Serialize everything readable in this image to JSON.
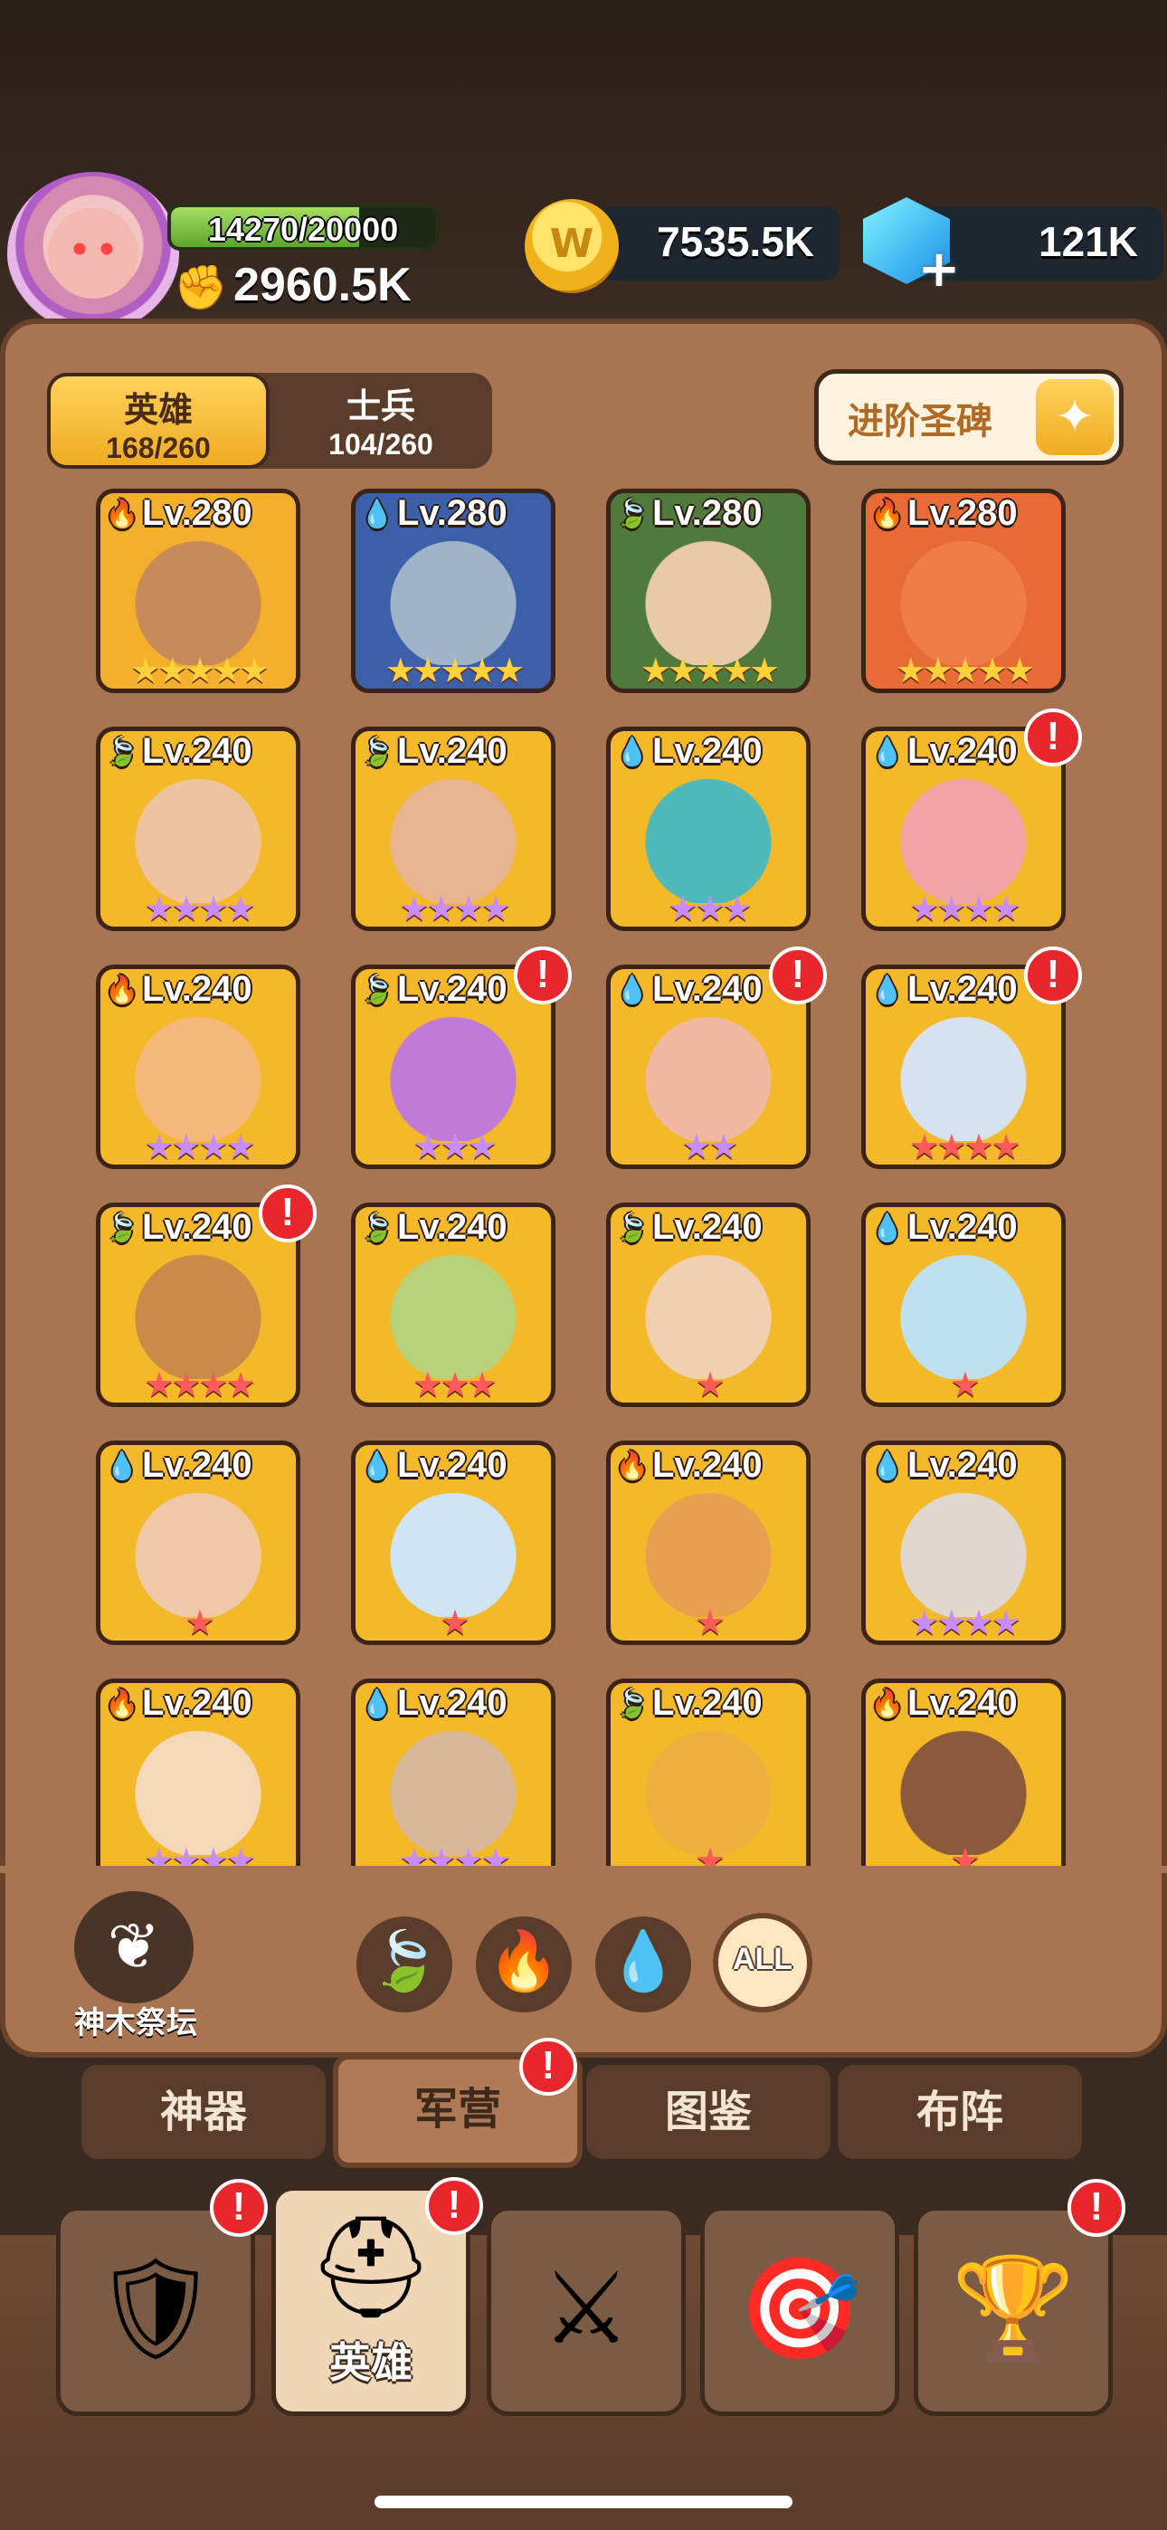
{
  "header": {
    "hp": {
      "text": "14270/20000",
      "fraction": 0.7135
    },
    "power": "2960.5K",
    "gold": "7535.5K",
    "gems": "121K"
  },
  "panel_tabs": [
    {
      "label": "英雄",
      "count": "168/260",
      "active": true
    },
    {
      "label": "士兵",
      "count": "104/260",
      "active": false
    }
  ],
  "ascend_button": {
    "label": "进阶圣碑"
  },
  "heroes": [
    {
      "level": "Lv.280",
      "element": "fire",
      "stars": 5,
      "star_color": "gold",
      "alert": false,
      "bg": "#f4b02c",
      "skin": "#c98a5a"
    },
    {
      "level": "Lv.280",
      "element": "water",
      "stars": 5,
      "star_color": "gold",
      "alert": false,
      "bg": "#3b5fa8",
      "skin": "#9fb4c8"
    },
    {
      "level": "Lv.280",
      "element": "leaf",
      "stars": 5,
      "star_color": "gold",
      "alert": false,
      "bg": "#4f7a3c",
      "skin": "#e8c9a8"
    },
    {
      "level": "Lv.280",
      "element": "fire",
      "stars": 5,
      "star_color": "gold",
      "alert": false,
      "bg": "#e86a36",
      "skin": "#f07c4a"
    },
    {
      "level": "Lv.240",
      "element": "leaf",
      "stars": 4,
      "star_color": "purple",
      "alert": false,
      "bg": "#f3b928",
      "skin": "#f0c3a0"
    },
    {
      "level": "Lv.240",
      "element": "leaf",
      "stars": 4,
      "star_color": "purple",
      "alert": false,
      "bg": "#f3b928",
      "skin": "#e9b590"
    },
    {
      "level": "Lv.240",
      "element": "water",
      "stars": 3,
      "star_color": "purple",
      "alert": false,
      "bg": "#f3b928",
      "skin": "#4fb8b8"
    },
    {
      "level": "Lv.240",
      "element": "water",
      "stars": 4,
      "star_color": "purple",
      "alert": true,
      "bg": "#f3b928",
      "skin": "#f0a4a4"
    },
    {
      "level": "Lv.240",
      "element": "fire",
      "stars": 4,
      "star_color": "purple",
      "alert": false,
      "bg": "#f3b928",
      "skin": "#f4b97a"
    },
    {
      "level": "Lv.240",
      "element": "leaf",
      "stars": 3,
      "star_color": "purple",
      "alert": true,
      "bg": "#f3b928",
      "skin": "#c27ad8"
    },
    {
      "level": "Lv.240",
      "element": "water",
      "stars": 2,
      "star_color": "purple",
      "alert": true,
      "bg": "#f3b928",
      "skin": "#f0b8a0"
    },
    {
      "level": "Lv.240",
      "element": "water",
      "stars": 4,
      "star_color": "red",
      "alert": true,
      "bg": "#f3b928",
      "skin": "#d6e2f0"
    },
    {
      "level": "Lv.240",
      "element": "leaf",
      "stars": 4,
      "star_color": "red",
      "alert": true,
      "bg": "#f3b928",
      "skin": "#c98a4a"
    },
    {
      "level": "Lv.240",
      "element": "leaf",
      "stars": 3,
      "star_color": "red",
      "alert": false,
      "bg": "#f3b928",
      "skin": "#b8d27a"
    },
    {
      "level": "Lv.240",
      "element": "leaf",
      "stars": 1,
      "star_color": "red",
      "alert": false,
      "bg": "#f3b928",
      "skin": "#f0d0b0"
    },
    {
      "level": "Lv.240",
      "element": "water",
      "stars": 1,
      "star_color": "red",
      "alert": false,
      "bg": "#f3b928",
      "skin": "#bfe0f0"
    },
    {
      "level": "Lv.240",
      "element": "water",
      "stars": 1,
      "star_color": "red",
      "alert": false,
      "bg": "#f3b928",
      "skin": "#f0c8a8"
    },
    {
      "level": "Lv.240",
      "element": "water",
      "stars": 1,
      "star_color": "red",
      "alert": false,
      "bg": "#f3b928",
      "skin": "#cfe4f4"
    },
    {
      "level": "Lv.240",
      "element": "fire",
      "stars": 1,
      "star_color": "red",
      "alert": false,
      "bg": "#f3b928",
      "skin": "#e8a050"
    },
    {
      "level": "Lv.240",
      "element": "water",
      "stars": 4,
      "star_color": "purple",
      "alert": false,
      "bg": "#f3b928",
      "skin": "#e0d8d0"
    },
    {
      "level": "Lv.240",
      "element": "fire",
      "stars": 4,
      "star_color": "purple",
      "alert": false,
      "bg": "#f3b928",
      "skin": "#f4d8b8"
    },
    {
      "level": "Lv.240",
      "element": "water",
      "stars": 4,
      "star_color": "purple",
      "alert": false,
      "bg": "#f3b928",
      "skin": "#d8b898"
    },
    {
      "level": "Lv.240",
      "element": "leaf",
      "stars": 1,
      "star_color": "red",
      "alert": false,
      "bg": "#f3b928",
      "skin": "#f0b040"
    },
    {
      "level": "Lv.240",
      "element": "fire",
      "stars": 1,
      "star_color": "red",
      "alert": false,
      "bg": "#f3b928",
      "skin": "#8a5a3a"
    }
  ],
  "altar": {
    "label": "神木祭坛"
  },
  "filters": [
    {
      "name": "leaf",
      "icon": "🍃"
    },
    {
      "name": "fire",
      "icon": "🔥"
    },
    {
      "name": "water",
      "icon": "💧"
    },
    {
      "name": "all",
      "label": "ALL"
    }
  ],
  "subtabs": [
    {
      "label": "神器",
      "active": false,
      "alert": false
    },
    {
      "label": "军营",
      "active": true,
      "alert": true
    },
    {
      "label": "图鉴",
      "active": false,
      "alert": false
    },
    {
      "label": "布阵",
      "active": false,
      "alert": false
    }
  ],
  "bottom_nav": [
    {
      "icon": "banner-sword-icon",
      "glyph": "🛡",
      "label": "",
      "active": false,
      "alert": true
    },
    {
      "icon": "viking-helmet-icon",
      "glyph": "⛑",
      "label": "英雄",
      "active": true,
      "alert": true
    },
    {
      "icon": "crossed-swords-icon",
      "glyph": "⚔",
      "label": "",
      "active": false,
      "alert": false
    },
    {
      "icon": "target-icon",
      "glyph": "🎯",
      "label": "",
      "active": false,
      "alert": false
    },
    {
      "icon": "trophy-icon",
      "glyph": "🏆",
      "label": "",
      "active": false,
      "alert": true
    }
  ],
  "element_colors": {
    "fire": "#f26a1b",
    "water": "#2f8fe0",
    "leaf": "#5cb83a"
  },
  "star_colors": {
    "gold": "#ffd23a",
    "purple": "#c98cff",
    "red": "#ff5a5a"
  }
}
